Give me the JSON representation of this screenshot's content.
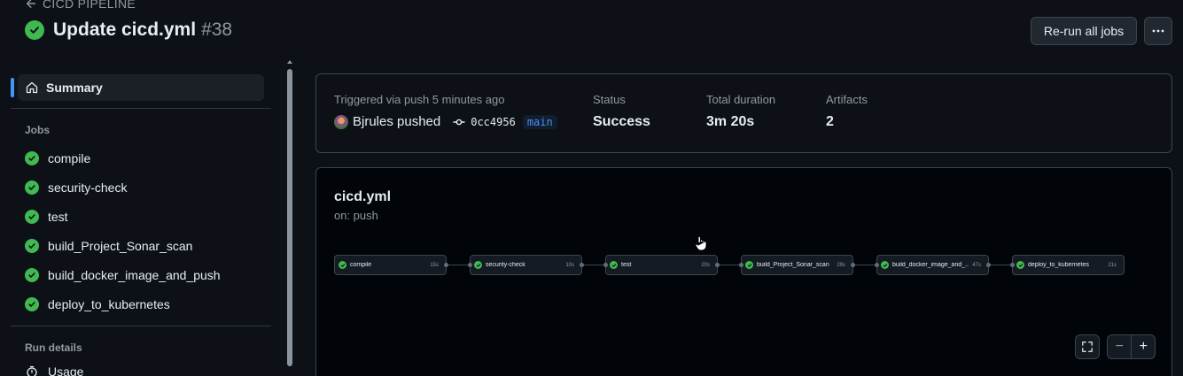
{
  "header": {
    "back_label": "CICD PIPELINE",
    "title": "Update cicd.yml",
    "run_number": "#38",
    "rerun_label": "Re-run all jobs",
    "status_icon": "check-circle-fill-icon",
    "more_icon": "kebab-horizontal-icon"
  },
  "sidebar": {
    "summary_label": "Summary",
    "summary_icon": "home-icon",
    "jobs_heading": "Jobs",
    "jobs": [
      {
        "label": "compile"
      },
      {
        "label": "security-check"
      },
      {
        "label": "test"
      },
      {
        "label": "build_Project_Sonar_scan"
      },
      {
        "label": "build_docker_image_and_push"
      },
      {
        "label": "deploy_to_kubernetes"
      }
    ],
    "run_details_heading": "Run details",
    "usage_label": "Usage",
    "usage_icon": "stopwatch-icon"
  },
  "summary_card": {
    "trigger_label": "Triggered via push 5 minutes ago",
    "pusher": "Bjrules pushed",
    "commit_sha": "0cc4956",
    "branch": "main",
    "status_label": "Status",
    "status_value": "Success",
    "duration_label": "Total duration",
    "duration_value": "3m 20s",
    "artifacts_label": "Artifacts",
    "artifacts_value": "2"
  },
  "workflow": {
    "file": "cicd.yml",
    "trigger": "on: push",
    "nodes": [
      {
        "name": "compile",
        "time": "15s"
      },
      {
        "name": "security-check",
        "time": "10s"
      },
      {
        "name": "test",
        "time": "20s"
      },
      {
        "name": "build_Project_Sonar_scan",
        "time": "29s"
      },
      {
        "name": "build_docker_image_and_...",
        "time": "47s"
      },
      {
        "name": "deploy_to_kubernetes",
        "time": "21s"
      }
    ],
    "zoom_out": "−",
    "zoom_in": "+"
  },
  "colors": {
    "background": "#0d1117",
    "success": "#3fb950",
    "accent": "#4493f8",
    "border": "#3d444d",
    "muted": "#9198a1"
  }
}
